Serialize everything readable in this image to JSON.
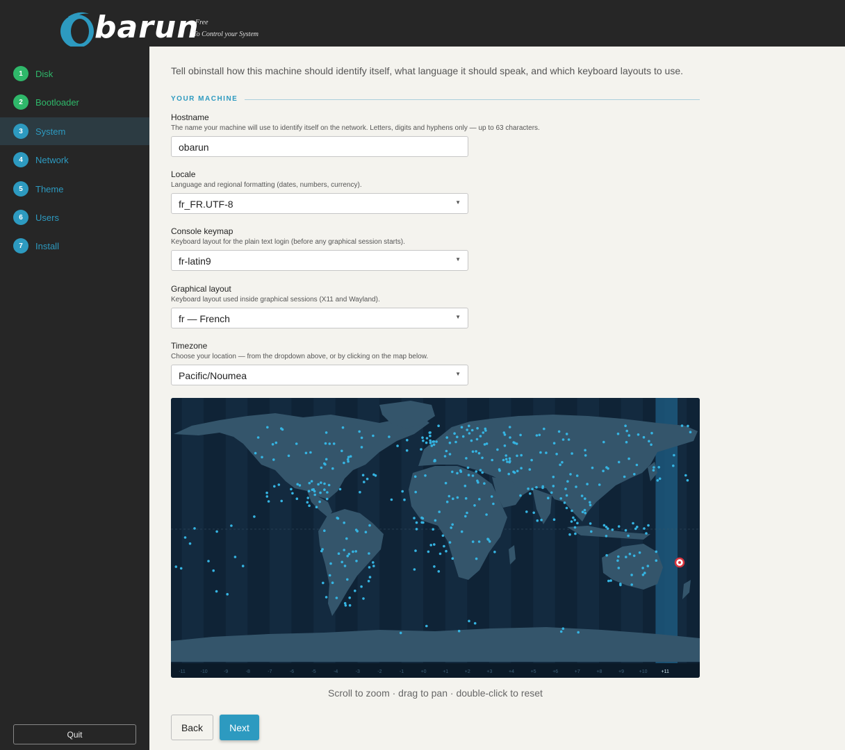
{
  "brand": {
    "name": "barun",
    "tagline_line1": "Free",
    "tagline_line2": "To Control your System",
    "accent": "#2d9ac0"
  },
  "sidebar": {
    "steps": [
      {
        "num": "1",
        "label": "Disk",
        "state": "done"
      },
      {
        "num": "2",
        "label": "Bootloader",
        "state": "done"
      },
      {
        "num": "3",
        "label": "System",
        "state": "active"
      },
      {
        "num": "4",
        "label": "Network",
        "state": "pending"
      },
      {
        "num": "5",
        "label": "Theme",
        "state": "pending"
      },
      {
        "num": "6",
        "label": "Users",
        "state": "pending"
      },
      {
        "num": "7",
        "label": "Install",
        "state": "pending"
      }
    ],
    "quit_label": "Quit",
    "colors": {
      "done": "#2fb86a",
      "pending": "#2d9ac0"
    }
  },
  "main": {
    "intro": "Tell obinstall how this machine should identify itself, what language it should speak, and which keyboard layouts to use.",
    "section_title": "YOUR MACHINE",
    "fields": {
      "hostname": {
        "label": "Hostname",
        "help": "The name your machine will use to identify itself on the network. Letters, digits and hyphens only — up to 63 characters.",
        "value": "obarun"
      },
      "locale": {
        "label": "Locale",
        "help": "Language and regional formatting (dates, numbers, currency).",
        "value": "fr_FR.UTF-8"
      },
      "keymap": {
        "label": "Console keymap",
        "help": "Keyboard layout for the plain text login (before any graphical session starts).",
        "value": "fr-latin9"
      },
      "layout": {
        "label": "Graphical layout",
        "help": "Keyboard layout used inside graphical sessions (X11 and Wayland).",
        "value": "fr — French"
      },
      "timezone": {
        "label": "Timezone",
        "help": "Choose your location — from the dropdown above, or by clicking on the map below.",
        "value": "Pacific/Noumea"
      }
    },
    "map": {
      "offsets": [
        "-11",
        "-10",
        "-9",
        "-8",
        "-7",
        "-6",
        "-5",
        "-4",
        "-3",
        "-2",
        "-1",
        "+0",
        "+1",
        "+2",
        "+3",
        "+4",
        "+5",
        "+6",
        "+7",
        "+8",
        "+9",
        "+10",
        "+11"
      ],
      "selected_offset": "+11",
      "hint": "Scroll to zoom · drag to pan · double-click to reset"
    },
    "back_label": "Back",
    "next_label": "Next"
  }
}
